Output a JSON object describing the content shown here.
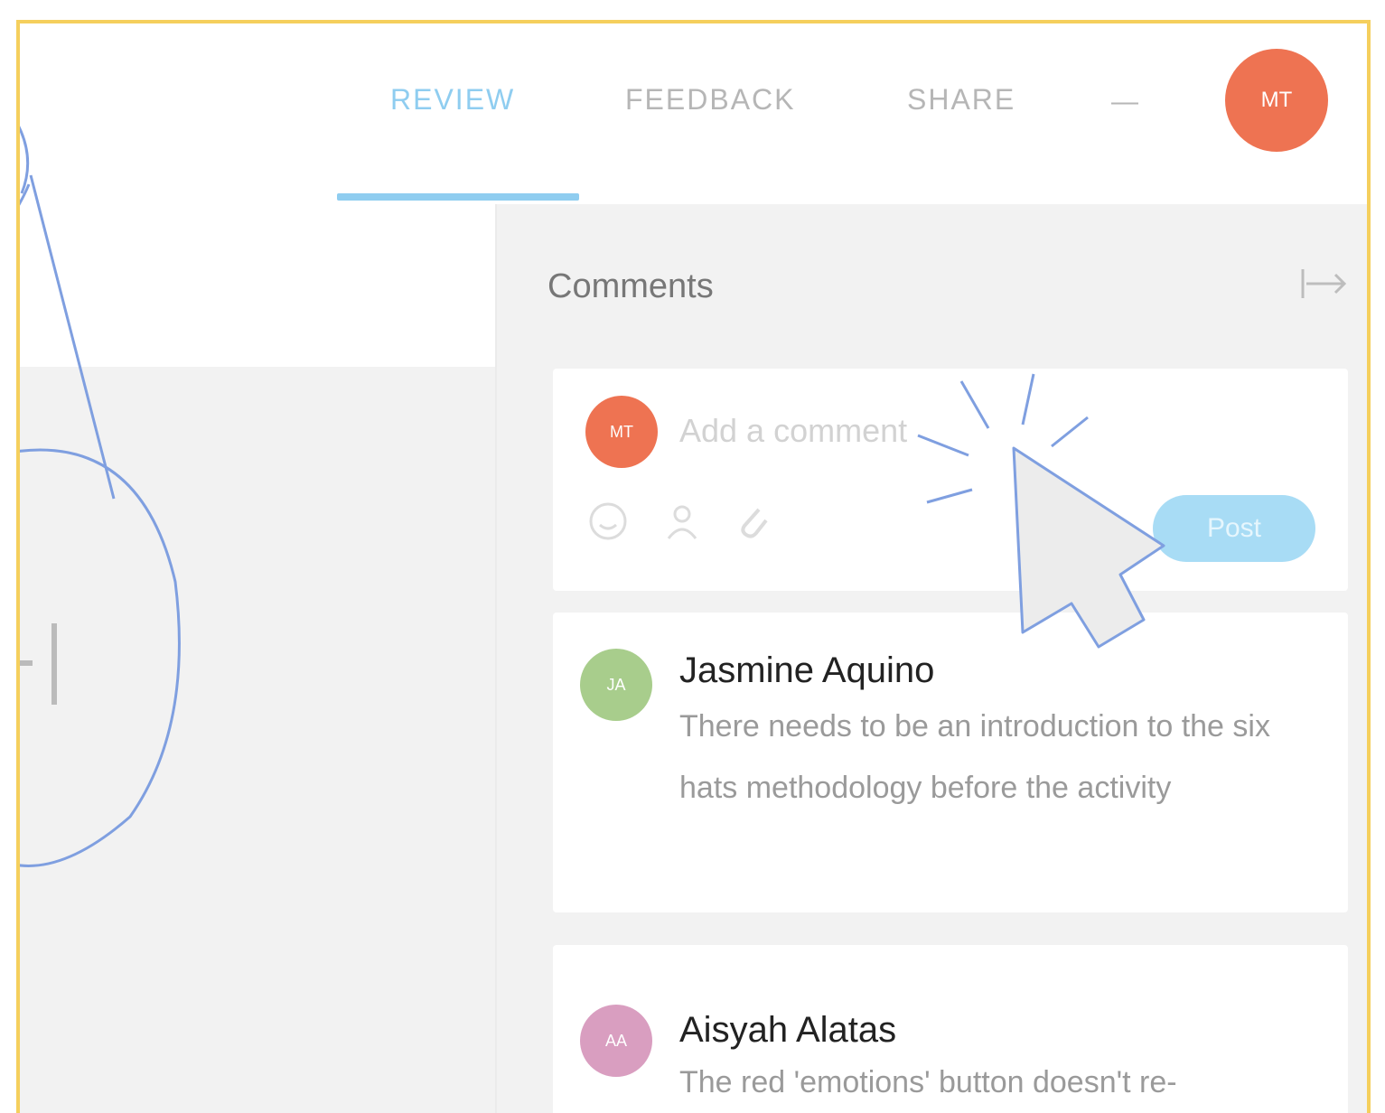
{
  "tabs": [
    {
      "label": "REVIEW",
      "active": true
    },
    {
      "label": "FEEDBACK",
      "active": false
    },
    {
      "label": "SHARE",
      "active": false
    }
  ],
  "more_label": "—",
  "user": {
    "initials": "MT",
    "color": "#ee7352"
  },
  "comments_panel": {
    "title": "Comments",
    "composer": {
      "initials": "MT",
      "placeholder": "Add a comment",
      "post_label": "Post"
    },
    "comments": [
      {
        "initials": "JA",
        "color": "#a8cd8c",
        "author": "Jasmine Aquino",
        "text": "There needs to be an introduction to the six hats methodology before the activity"
      },
      {
        "initials": "AA",
        "color": "#d99ec0",
        "author": "Aisyah Alatas",
        "text": "The red 'emotions' button doesn't re-"
      }
    ]
  },
  "colors": {
    "accent": "#8fcdf0",
    "frame": "#f5cf5d",
    "callout_stroke": "#7f9fe0"
  },
  "icons": [
    "collapse-panel-icon",
    "emoji-icon",
    "mention-icon",
    "attach-icon",
    "cursor-icon",
    "split-handle-icon"
  ]
}
